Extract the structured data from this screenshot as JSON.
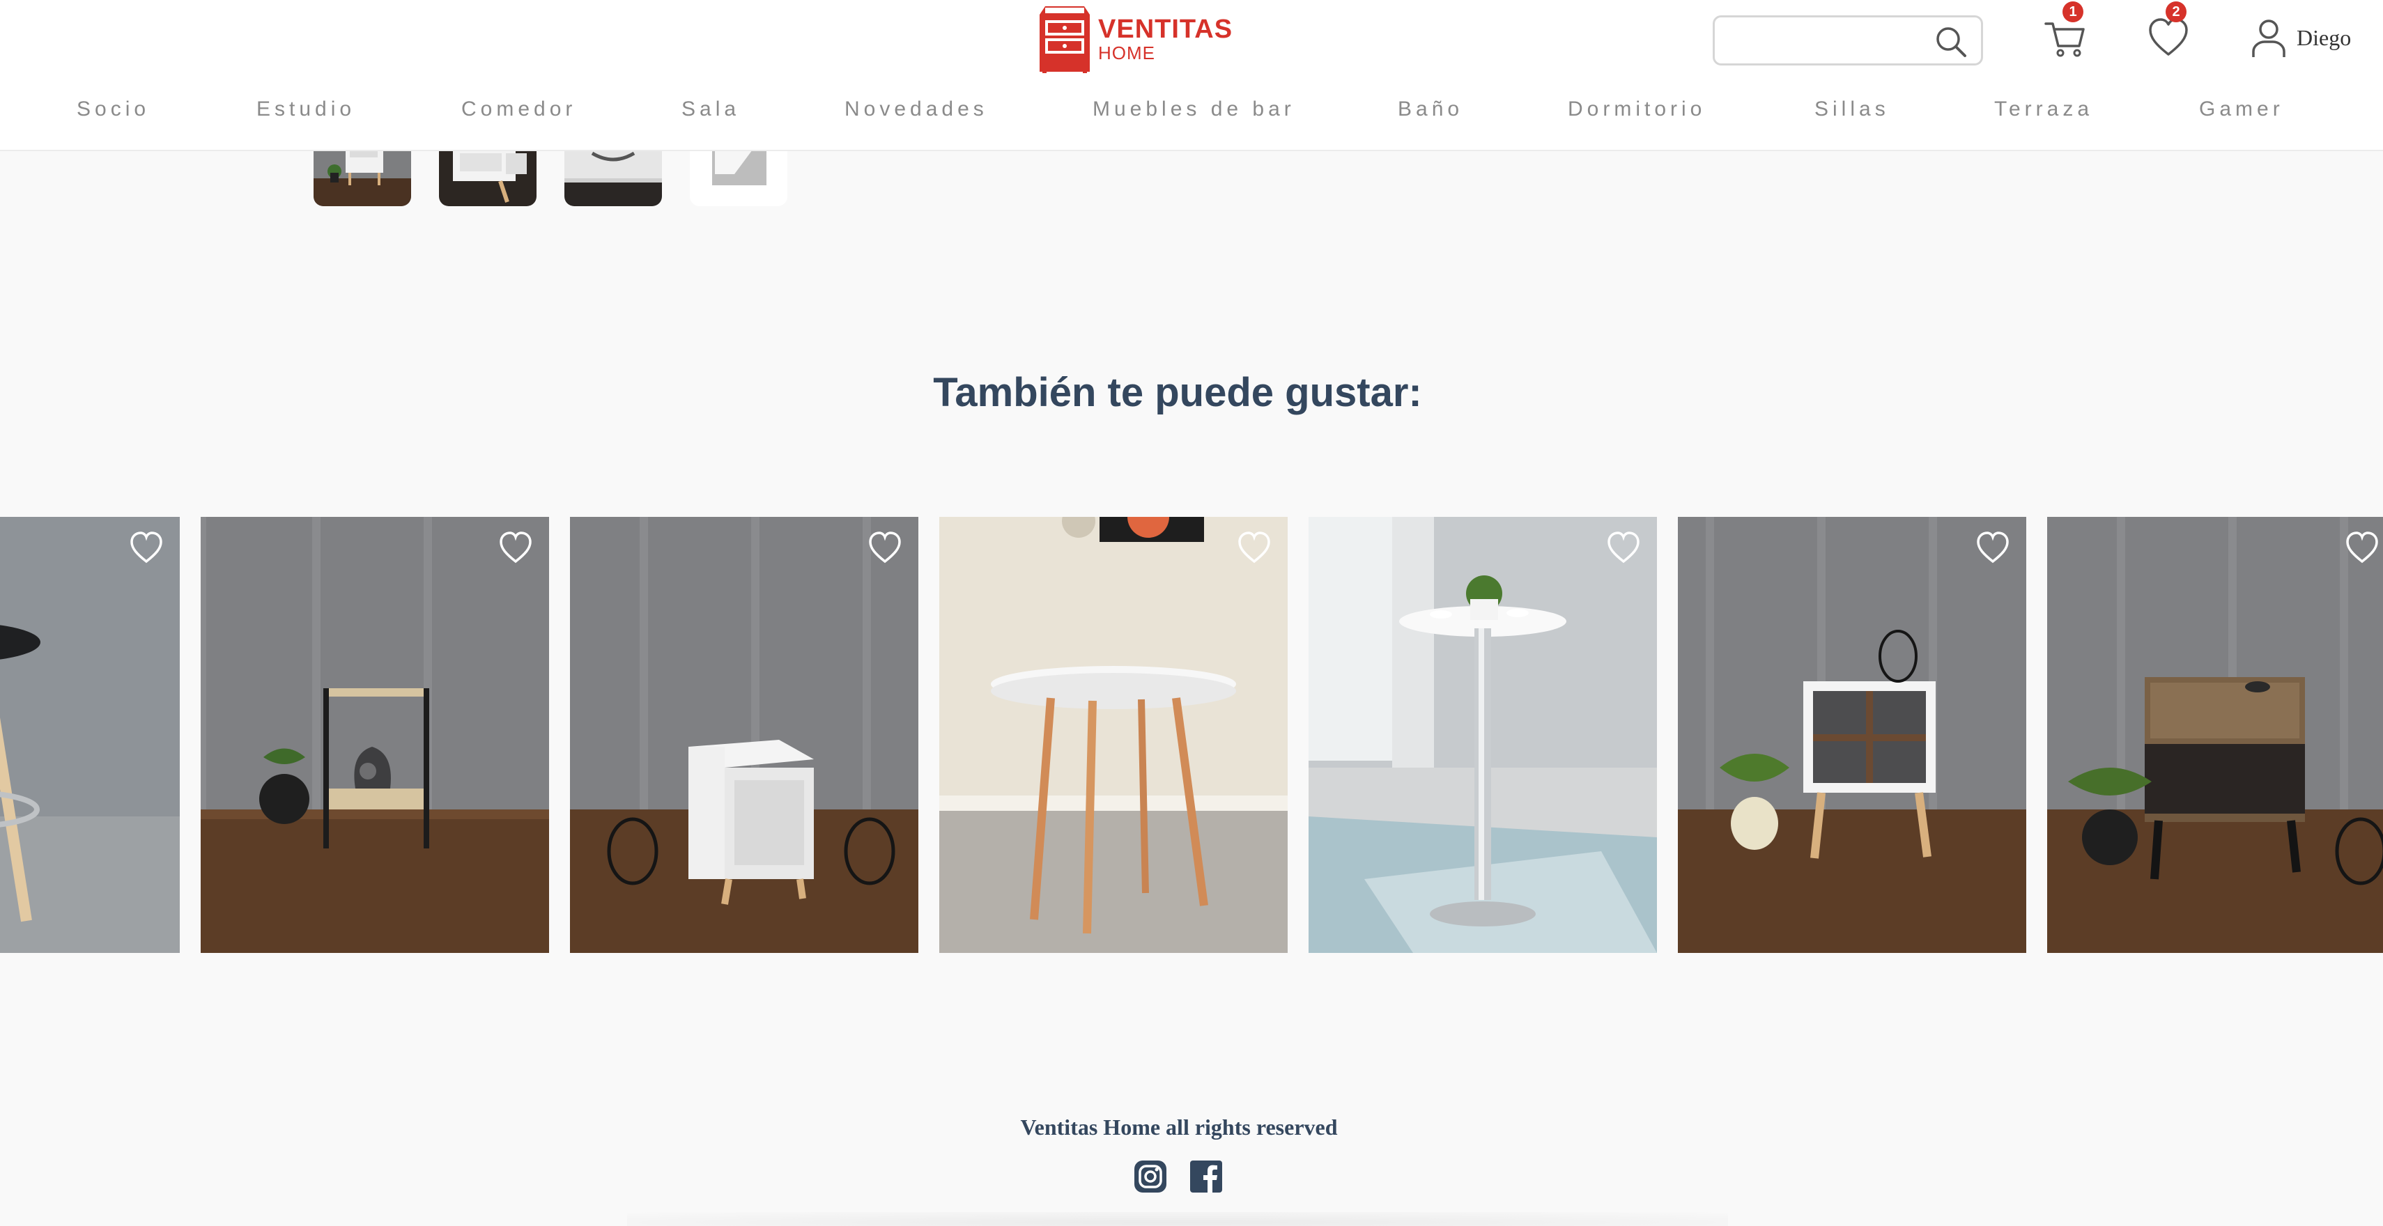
{
  "brand": {
    "name_line1": "VENTITAS",
    "name_line2": "HOME",
    "accent_color": "#d6322a",
    "logo_icon": "cabinet-logo-icon"
  },
  "header": {
    "search": {
      "placeholder": "",
      "value": "",
      "icon": "search-icon"
    },
    "cart": {
      "icon": "cart-icon",
      "count": "1"
    },
    "wishlist": {
      "icon": "heart-icon",
      "count": "2"
    },
    "user": {
      "icon": "user-icon",
      "name": "Diego"
    }
  },
  "nav": {
    "items": [
      {
        "label": "Socio"
      },
      {
        "label": "Estudio"
      },
      {
        "label": "Comedor"
      },
      {
        "label": "Sala"
      },
      {
        "label": "Novedades"
      },
      {
        "label": "Muebles de bar"
      },
      {
        "label": "Baño"
      },
      {
        "label": "Dormitorio"
      },
      {
        "label": "Sillas"
      },
      {
        "label": "Terraza"
      },
      {
        "label": "Gamer"
      }
    ],
    "text_color": "#8a8a8a"
  },
  "gallery_thumbnails": [
    {
      "subject": "white-nightstand-thumbnail"
    },
    {
      "subject": "nightstand-drawer-thumbnail"
    },
    {
      "subject": "drawer-detail-thumbnail"
    },
    {
      "subject": "white-panel-thumbnail"
    }
  ],
  "recommendations": {
    "title": "También te puede gustar:",
    "title_color": "#34475e",
    "products": [
      {
        "subject": "bar-stool-black-seat",
        "favorite_icon": "heart-outline-icon"
      },
      {
        "subject": "black-metal-side-table",
        "favorite_icon": "heart-outline-icon"
      },
      {
        "subject": "white-cube-side-table",
        "favorite_icon": "heart-outline-icon"
      },
      {
        "subject": "round-white-table-wood-legs",
        "favorite_icon": "heart-outline-icon"
      },
      {
        "subject": "chrome-bar-table",
        "favorite_icon": "heart-outline-icon"
      },
      {
        "subject": "white-cross-shelf-nightstand",
        "favorite_icon": "heart-outline-icon"
      },
      {
        "subject": "wood-drawer-nightstand",
        "favorite_icon": "heart-outline-icon"
      }
    ]
  },
  "footer": {
    "rights": "Ventitas Home all rights reserved",
    "social": [
      {
        "icon": "instagram-icon"
      },
      {
        "icon": "facebook-icon"
      }
    ]
  }
}
